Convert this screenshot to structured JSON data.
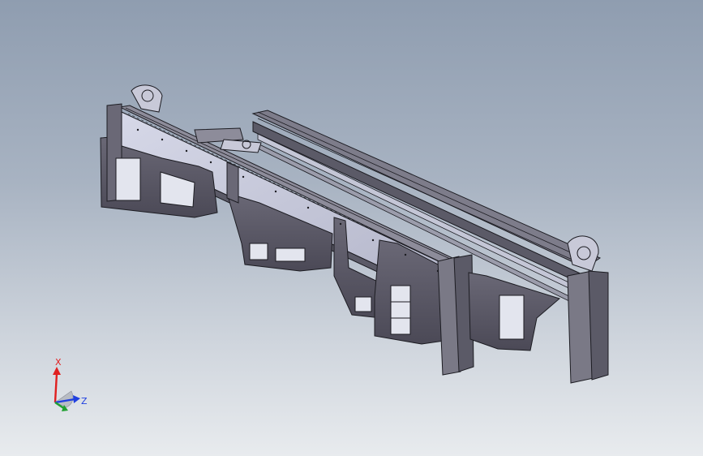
{
  "viewport": {
    "background_top": "#8f9db0",
    "background_bottom": "#e8ebee",
    "part_color": "#5c5a66",
    "edge_color": "#1c1c22",
    "face_light": "#c9cbdc"
  },
  "triad": {
    "x_label": "X",
    "z_label": "Z",
    "x_color": "#e02020",
    "y_color": "#20a030",
    "z_color": "#2040e0"
  }
}
